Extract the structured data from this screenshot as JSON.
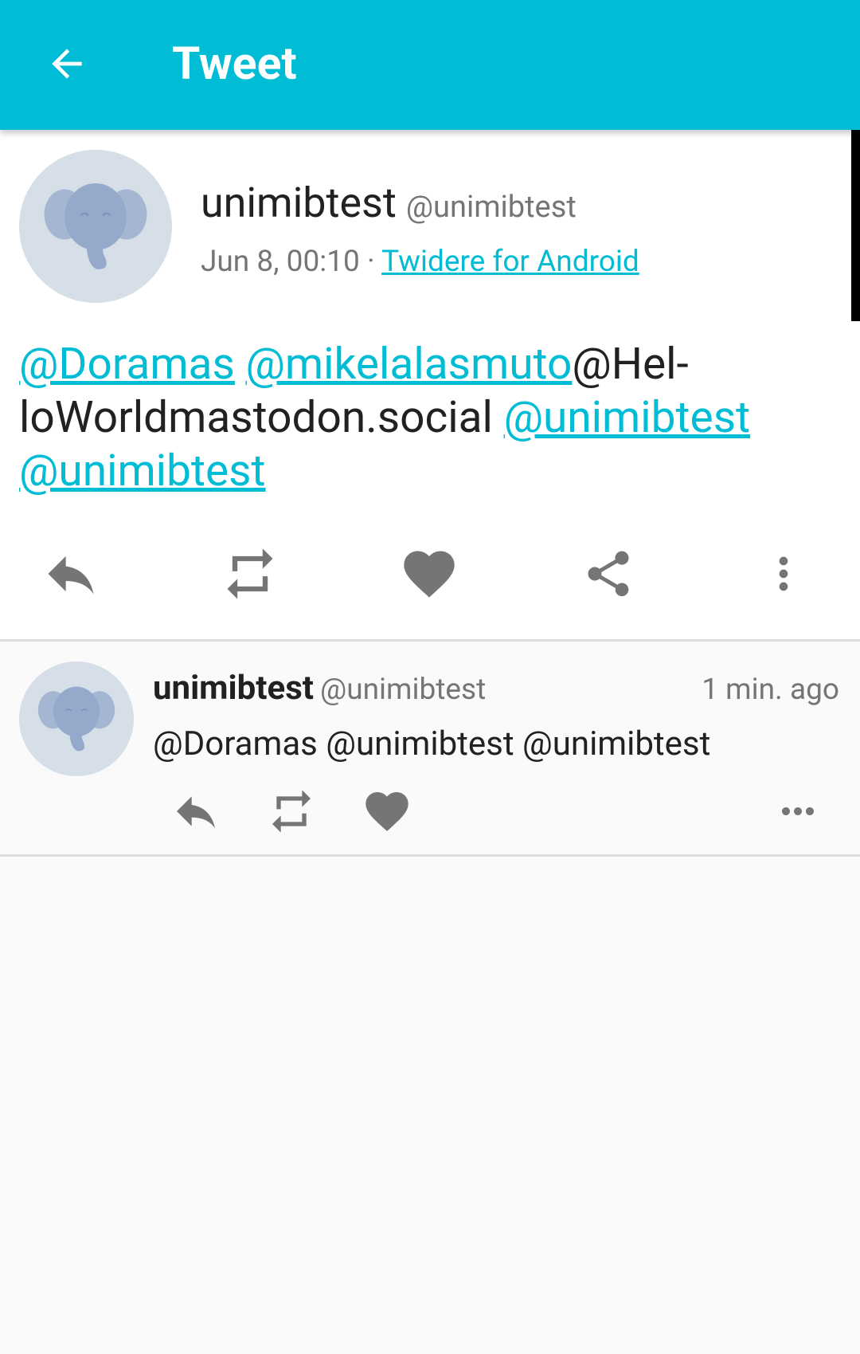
{
  "toolbar": {
    "title": "Tweet",
    "back_icon": "arrow-back-icon",
    "color": "#00bcd4"
  },
  "status": {
    "display_name": "unimibtest",
    "handle": "@unimibtest",
    "time": "Jun 8, 00:10 · ",
    "source": "Twidere for Android",
    "text_parts": {
      "mention_1": "@Doramas",
      "mention_2": "@mikelalasmuto",
      "plain_1": "@Hel-loWorldmastodon.social",
      "mention_3": "@unimibtest",
      "mention_4": "@unimibtest"
    },
    "actions": {
      "reply": "reply-icon",
      "retweet": "retweet-icon",
      "like": "heart-icon",
      "share": "share-icon",
      "more": "more-vertical-icon"
    }
  },
  "reply": {
    "display_name": "unimibtest",
    "handle": "@unimibtest",
    "time": "1 min. ago",
    "text": "@Doramas @unimibtest @unimibtest",
    "actions": {
      "reply": "reply-icon",
      "retweet": "retweet-icon",
      "like": "heart-icon",
      "more": "more-horizontal-icon"
    }
  },
  "colors": {
    "accent": "#00bcd4",
    "icon_gray": "#757575",
    "text_primary": "#212121"
  }
}
